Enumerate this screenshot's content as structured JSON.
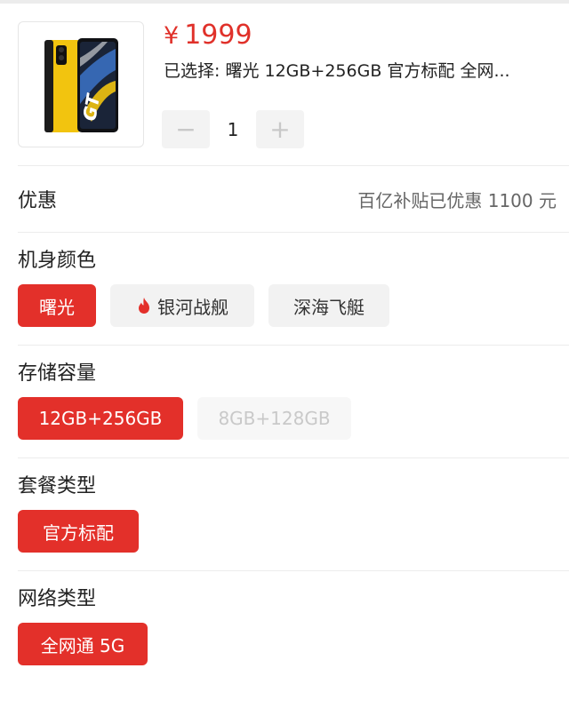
{
  "product": {
    "price_symbol": "¥",
    "price": "1999",
    "selected_info": "已选择: 曙光 12GB+256GB 官方标配 全网...",
    "quantity": "1",
    "minus_label": "−",
    "plus_label": "+",
    "image_icon": "phone-image"
  },
  "discount": {
    "label": "优惠",
    "value": "百亿补贴已优惠 1100 元"
  },
  "sections": {
    "color": {
      "title": "机身颜色",
      "options": [
        "曙光",
        "银河战舰",
        "深海飞艇"
      ],
      "selected": "曙光",
      "hot_option_icon": "flame-icon"
    },
    "storage": {
      "title": "存储容量",
      "options": [
        "12GB+256GB",
        "8GB+128GB"
      ],
      "selected": "12GB+256GB",
      "disabled": [
        "8GB+128GB"
      ]
    },
    "package": {
      "title": "套餐类型",
      "options": [
        "官方标配"
      ],
      "selected": "官方标配"
    },
    "network": {
      "title": "网络类型",
      "options": [
        "全网通 5G"
      ],
      "selected": "全网通 5G"
    }
  },
  "colors": {
    "accent": "#e3302a",
    "chip_bg": "#f2f2f2",
    "disabled_text": "#c9c9c9",
    "phone_body": "#f2c40f"
  }
}
